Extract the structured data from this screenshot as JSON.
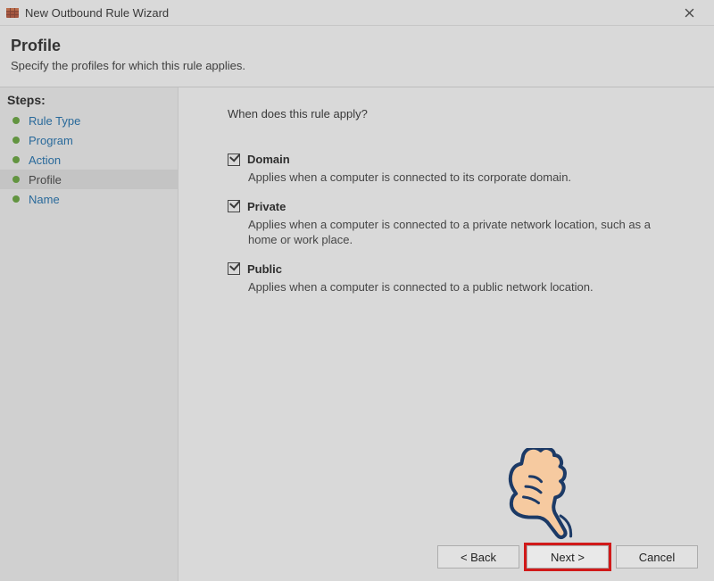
{
  "window": {
    "title": "New Outbound Rule Wizard"
  },
  "header": {
    "title": "Profile",
    "subtitle": "Specify the profiles for which this rule applies."
  },
  "sidebar": {
    "steps_label": "Steps:",
    "items": [
      {
        "label": "Rule Type",
        "current": false
      },
      {
        "label": "Program",
        "current": false
      },
      {
        "label": "Action",
        "current": false
      },
      {
        "label": "Profile",
        "current": true
      },
      {
        "label": "Name",
        "current": false
      }
    ]
  },
  "main": {
    "prompt": "When does this rule apply?",
    "options": [
      {
        "key": "domain",
        "title": "Domain",
        "checked": true,
        "desc": "Applies when a computer is connected to its corporate domain."
      },
      {
        "key": "private",
        "title": "Private",
        "checked": true,
        "desc": "Applies when a computer is connected to a private network location, such as a home or work place."
      },
      {
        "key": "public",
        "title": "Public",
        "checked": true,
        "desc": "Applies when a computer is connected to a public network location."
      }
    ]
  },
  "footer": {
    "back": "< Back",
    "next": "Next >",
    "cancel": "Cancel"
  },
  "annotation": {
    "highlight_button": "next",
    "pointer_hand": true
  }
}
